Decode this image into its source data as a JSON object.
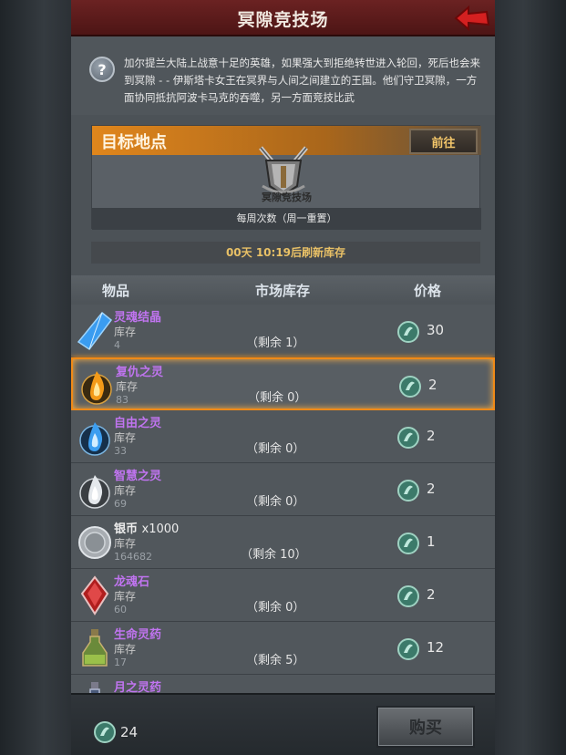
{
  "header": {
    "title": "冥隙竞技场",
    "back_icon": "back-arrow-icon"
  },
  "intro": {
    "help_icon_glyph": "?",
    "text": "加尔提兰大陆上战意十足的英雄，如果强大到拒绝转世进入轮回，死后也会来到冥隙 - - 伊斯塔卡女王在冥界与人间之间建立的王国。他们守卫冥隙，一方面协同抵抗阿波卡马克的吞噬，另一方面竞技比武"
  },
  "target": {
    "title": "目标地点",
    "go_label": "前往",
    "arena_name": "冥隙竞技场",
    "weekly_text": "每周次数（周一重置）"
  },
  "refresh_text": "00天 10:19后刷新库存",
  "table": {
    "headers": {
      "item": "物品",
      "stock": "市场库存",
      "price": "价格"
    },
    "stock_label": "库存",
    "rows": [
      {
        "name": "灵魂结晶",
        "stock": "4",
        "remain": "（剩余 1）",
        "price": "30",
        "icon": "blue-crystal-icon",
        "name_color": "purple"
      },
      {
        "name": "复仇之灵",
        "stock": "83",
        "remain": "（剩余 0）",
        "price": "2",
        "icon": "orange-flame-spirit-icon",
        "name_color": "purple"
      },
      {
        "name": "自由之灵",
        "stock": "33",
        "remain": "（剩余 0）",
        "price": "2",
        "icon": "blue-flame-spirit-icon",
        "name_color": "purple"
      },
      {
        "name": "智慧之灵",
        "stock": "69",
        "remain": "（剩余 0）",
        "price": "2",
        "icon": "white-flame-spirit-icon",
        "name_color": "purple"
      },
      {
        "name": "银币",
        "name_suffix": "x1000",
        "stock": "164682",
        "remain": "（剩余 10）",
        "price": "1",
        "icon": "silver-coin-icon",
        "name_color": "white"
      },
      {
        "name": "龙魂石",
        "stock": "60",
        "remain": "（剩余 0）",
        "price": "2",
        "icon": "red-dragon-stone-icon",
        "name_color": "purple"
      },
      {
        "name": "生命灵药",
        "stock": "17",
        "remain": "（剩余 5）",
        "price": "12",
        "icon": "green-potion-icon",
        "name_color": "purple"
      },
      {
        "name": "月之灵药",
        "stock": "",
        "remain": "",
        "price": "",
        "icon": "moon-potion-icon",
        "name_color": "purple"
      }
    ],
    "selected_index": 1
  },
  "footer": {
    "currency_amount": "24",
    "currency_icon": "arena-coin-icon",
    "buy_label": "购买"
  },
  "colors": {
    "title_bar": "#5a1a1a",
    "accent_orange": "#f08a18",
    "purple_name": "#c074f0"
  }
}
